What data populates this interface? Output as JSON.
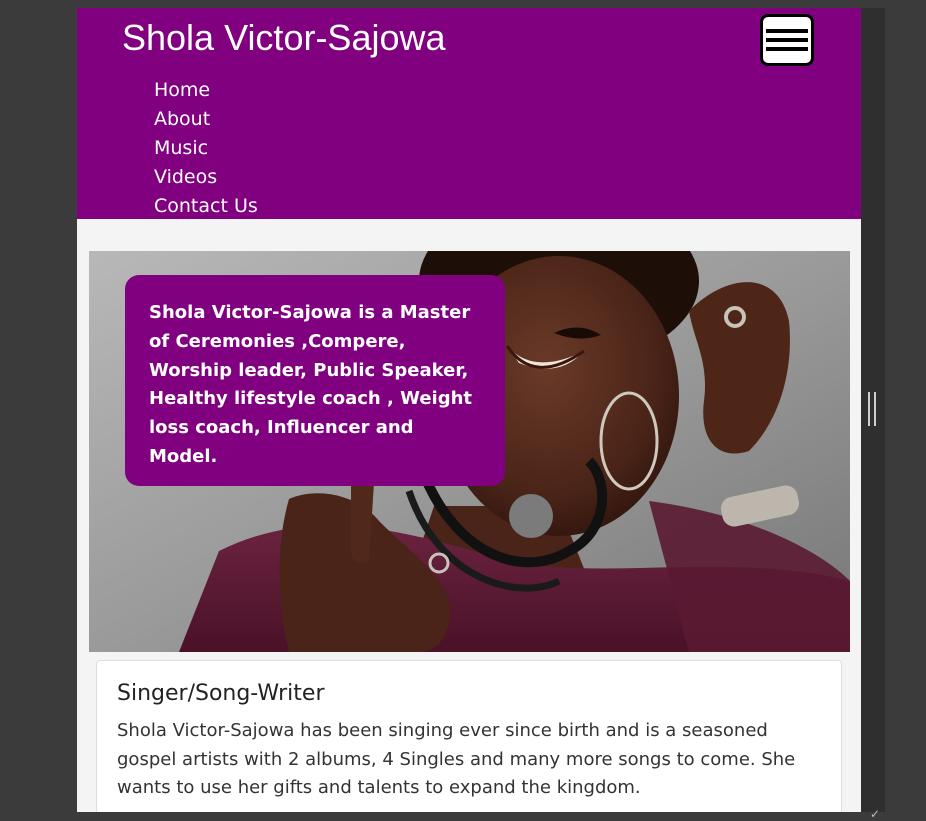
{
  "header": {
    "title": "Shola Victor-Sajowa",
    "menu_icon": "hamburger-menu-icon",
    "brand_color": "#800080"
  },
  "nav": {
    "items": [
      {
        "label": "Home"
      },
      {
        "label": "About"
      },
      {
        "label": "Music"
      },
      {
        "label": "Videos"
      },
      {
        "label": "Contact Us"
      }
    ]
  },
  "hero": {
    "image": "portrait-photo",
    "caption": "Shola Victor-Sajowa is a Master of Ceremonies ,Compere, Worship leader, Public Speaker, Healthy lifestyle coach , Weight loss coach, Influencer and Model."
  },
  "card": {
    "title": "Singer/Song-Writer",
    "body": "Shola Victor-Sajowa has been singing ever since birth and is a seasoned gospel artists with 2 albums, 4 Singles and many more songs to come. She wants to use her gifts and talents to expand the kingdom."
  }
}
